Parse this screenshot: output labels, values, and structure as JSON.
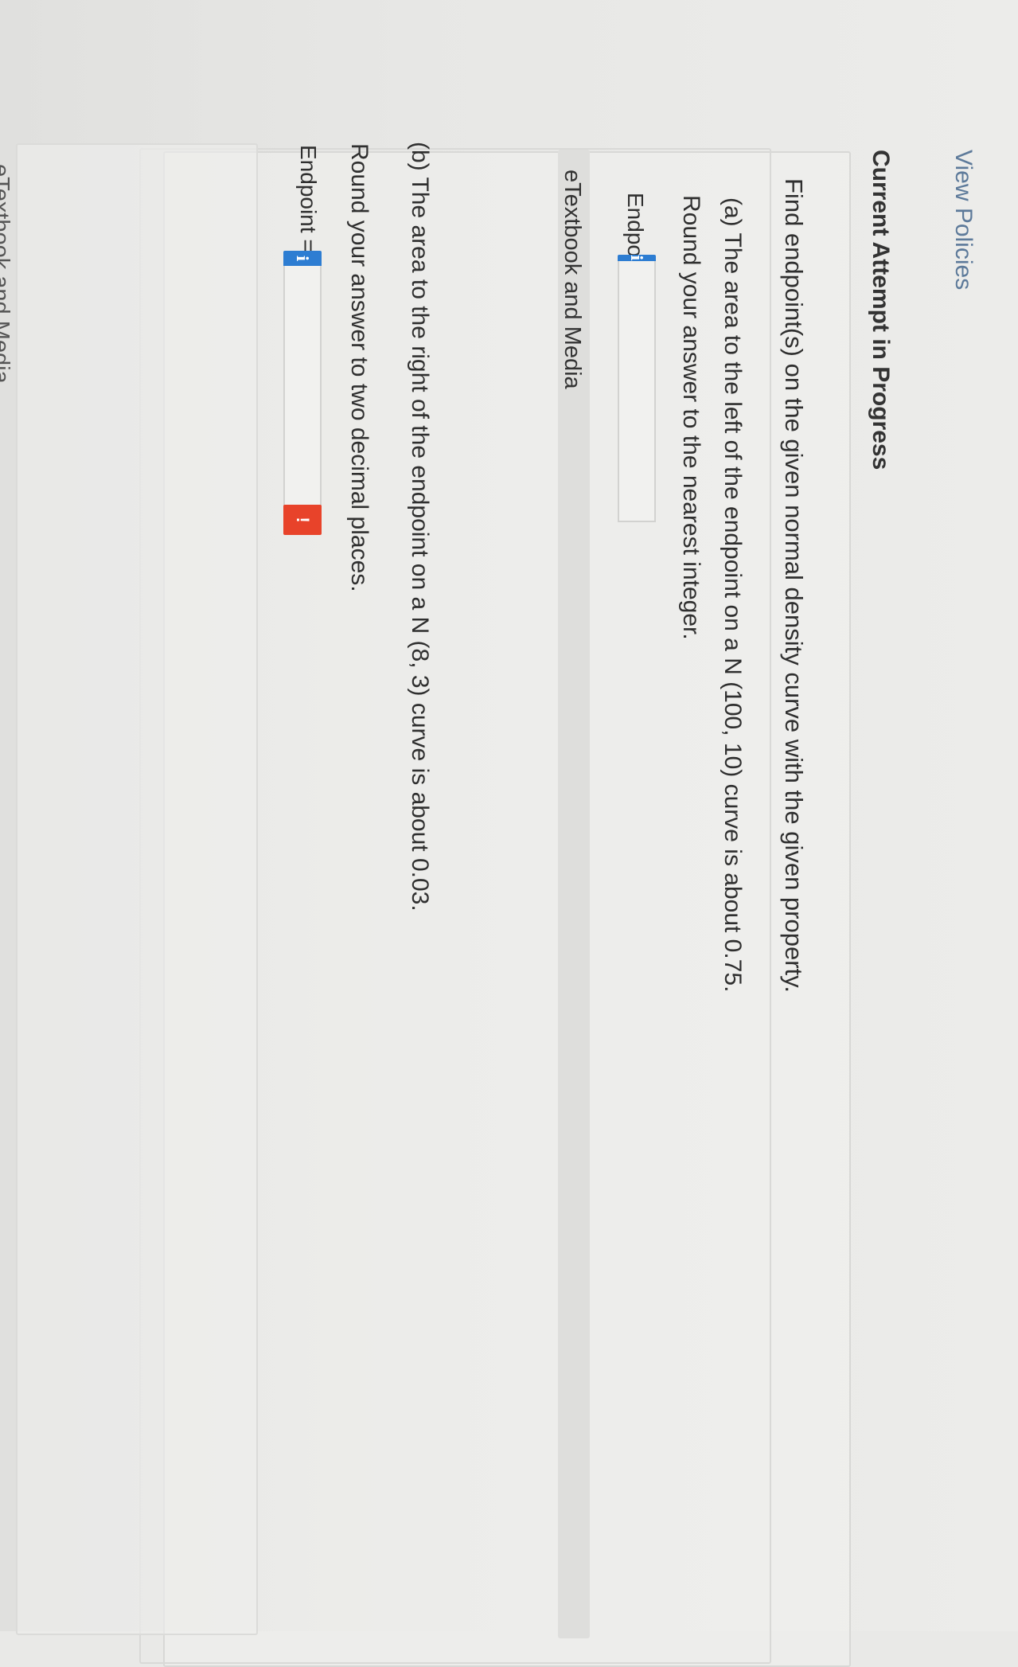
{
  "header": {
    "view_policies": "View Policies",
    "attempt_title": "Current Attempt in Progress"
  },
  "question": {
    "intro": "Find endpoint(s) on the given normal density curve with the given property.",
    "part_a": {
      "text": "(a) The area to the left of the endpoint on a N (100, 10) curve is about 0.75.",
      "round": "Round your answer to the nearest integer.",
      "endpoint_label": "Endpoint =",
      "value": ""
    },
    "part_b": {
      "text": "(b) The area to the right of the endpoint on a N (8, 3) curve is about 0.03.",
      "round": "Round your answer to two decimal places.",
      "endpoint_label": "Endpoint =",
      "value": ""
    }
  },
  "media": {
    "label": "eTextbook and Media"
  },
  "footer": {
    "partial_label": "eTextbook and Media"
  },
  "icons": {
    "info": "info-icon",
    "alert": "alert-icon"
  },
  "colors": {
    "info_button": "#2d7dd2",
    "alert_button": "#e8432a",
    "link": "#5d7a9a"
  }
}
